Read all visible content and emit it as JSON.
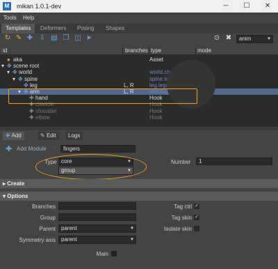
{
  "titlebar": {
    "app_initial": "M",
    "title": "mikan 1.0.1-dev",
    "minimize": "─",
    "maximize": "☐",
    "close": "✕"
  },
  "menubar": {
    "tools": "Tools",
    "help": "Help"
  },
  "tabs": {
    "templates": "Templates",
    "deformers": "Deformers",
    "posing": "Posing",
    "shapes": "Shapes"
  },
  "toolbar": {
    "mode": "anim",
    "icons": [
      "refresh-icon",
      "brush-icon",
      "add-icon",
      "import-icon",
      "export-icon",
      "duplicate-icon",
      "layers-icon",
      "select-icon",
      "hook-icon",
      "tools-icon",
      "close-icon"
    ]
  },
  "tree": {
    "headers": {
      "id": "id",
      "branches": "branches",
      "type": "type",
      "mode": "mode"
    },
    "rows": [
      {
        "id": "aka",
        "type": "Asset",
        "branches": "",
        "indent": 0
      },
      {
        "id": "scene root",
        "type": "",
        "branches": "",
        "indent": 0
      },
      {
        "id": "world",
        "type": "world.character",
        "branches": "",
        "indent": 1
      },
      {
        "id": "spine",
        "type": "spine.legacy",
        "branches": "",
        "indent": 2
      },
      {
        "id": "leg",
        "type": "leg.legacy",
        "branches": "L, R",
        "indent": 3
      },
      {
        "id": "arm",
        "type": "arm.legacy",
        "branches": "L, R",
        "indent": 3
      },
      {
        "id": "hand",
        "type": "Hook",
        "branches": "",
        "indent": 4
      },
      {
        "id": "clavicle",
        "type": "Hook",
        "branches": "",
        "indent": 4
      },
      {
        "id": "shoulder",
        "type": "Hook",
        "branches": "",
        "indent": 4
      },
      {
        "id": "elbow",
        "type": "Hook",
        "branches": "",
        "indent": 4
      }
    ]
  },
  "subtabs": {
    "add": "Add",
    "edit": "Edit",
    "logs": "Logs"
  },
  "add_module": {
    "label": "Add Module",
    "value": "fingers"
  },
  "type_row": {
    "label": "Type",
    "value": "core",
    "sub_value": "group"
  },
  "number": {
    "label": "Number",
    "value": "1"
  },
  "sections": {
    "create": "Create",
    "options": "Options"
  },
  "options": {
    "branches_label": "Branches",
    "branches_value": "",
    "group_label": "Group",
    "group_value": "",
    "parent_label": "Parent",
    "parent_value": "parent",
    "sym_label": "Symmetry axis",
    "sym_value": "parent",
    "tagctrl_label": "Tag ctrl",
    "tagctrl_check": "✓",
    "tagskin_label": "Tag skin",
    "tagskin_check": "✓",
    "isolate_label": "Isolate skin",
    "main_label": "Main"
  },
  "colors": {
    "highlight": "#f0a020",
    "selection": "#51698a"
  }
}
